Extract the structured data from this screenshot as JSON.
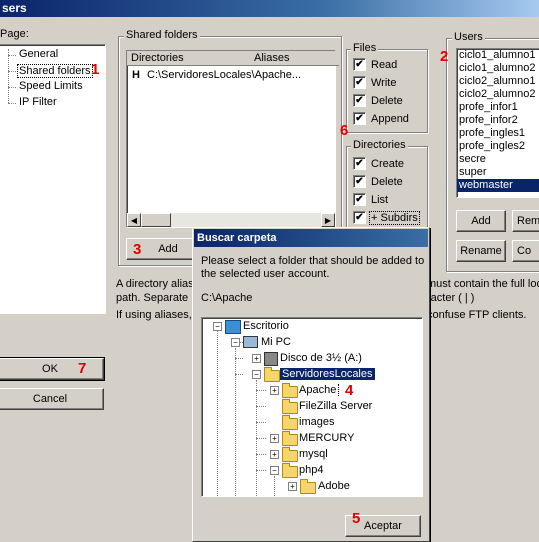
{
  "window": {
    "title": "sers"
  },
  "page_panel": {
    "label": "Page:",
    "items": [
      "General",
      "Shared folders",
      "Speed Limits",
      "IP Filter"
    ],
    "selected": "Shared folders"
  },
  "shared": {
    "group_label": "Shared folders",
    "col_dirs": "Directories",
    "col_aliases": "Aliases",
    "row_flag": "H",
    "row_dir": "C:\\ServidoresLocales\\Apache...",
    "add_label": "Add"
  },
  "files": {
    "group_label": "Files",
    "items": [
      {
        "label": "Read",
        "checked": "✔"
      },
      {
        "label": "Write",
        "checked": "✔"
      },
      {
        "label": "Delete",
        "checked": "✔"
      },
      {
        "label": "Append",
        "checked": "✔"
      }
    ]
  },
  "dirs": {
    "group_label": "Directories",
    "items": [
      {
        "label": "Create",
        "checked": "✔"
      },
      {
        "label": "Delete",
        "checked": "✔"
      },
      {
        "label": "List",
        "checked": "✔"
      },
      {
        "label": "+ Subdirs",
        "checked": "✔"
      }
    ]
  },
  "users": {
    "group_label": "Users",
    "list": [
      "ciclo1_alumno1",
      "ciclo1_alumno2",
      "ciclo2_alumno1",
      "ciclo2_alumno2",
      "profe_infor1",
      "profe_infor2",
      "profe_ingles1",
      "profe_ingles2",
      "secre",
      "super",
      "webmaster"
    ],
    "selected": "webmaster",
    "add_label": "Add",
    "remove_label": "Rem",
    "rename_label": "Rename",
    "copy_label": "Co"
  },
  "info": {
    "line1a": "A directory alias",
    "line1b": "must contain the full loca",
    "line2a": "path. Separate m",
    "line2b": "racter ( | )",
    "line3a": "If using aliases, p",
    "line3b": "confuse FTP clients."
  },
  "footer": {
    "ok_label": "OK",
    "cancel_label": "Cancel"
  },
  "dialog": {
    "title": "Buscar carpeta",
    "prompt1": "Please select a folder that should be added to t",
    "prompt2": "the selected user account.",
    "path": "C:\\Apache",
    "accept_label": "Aceptar",
    "tree": {
      "desktop": "Escritorio",
      "mypc": "Mi PC",
      "floppy": "Disco de 3½ (A:)",
      "servidores": "ServidoresLocales",
      "apache": "Apache",
      "filezilla": "FileZilla Server",
      "images": "images",
      "mercury": "MERCURY",
      "mysql": "mysql",
      "php4": "php4",
      "adobe": "Adobe"
    }
  },
  "markers": {
    "m1": "1",
    "m2": "2",
    "m3": "3",
    "m4": "4",
    "m5": "5",
    "m6": "6",
    "m7": "7"
  }
}
